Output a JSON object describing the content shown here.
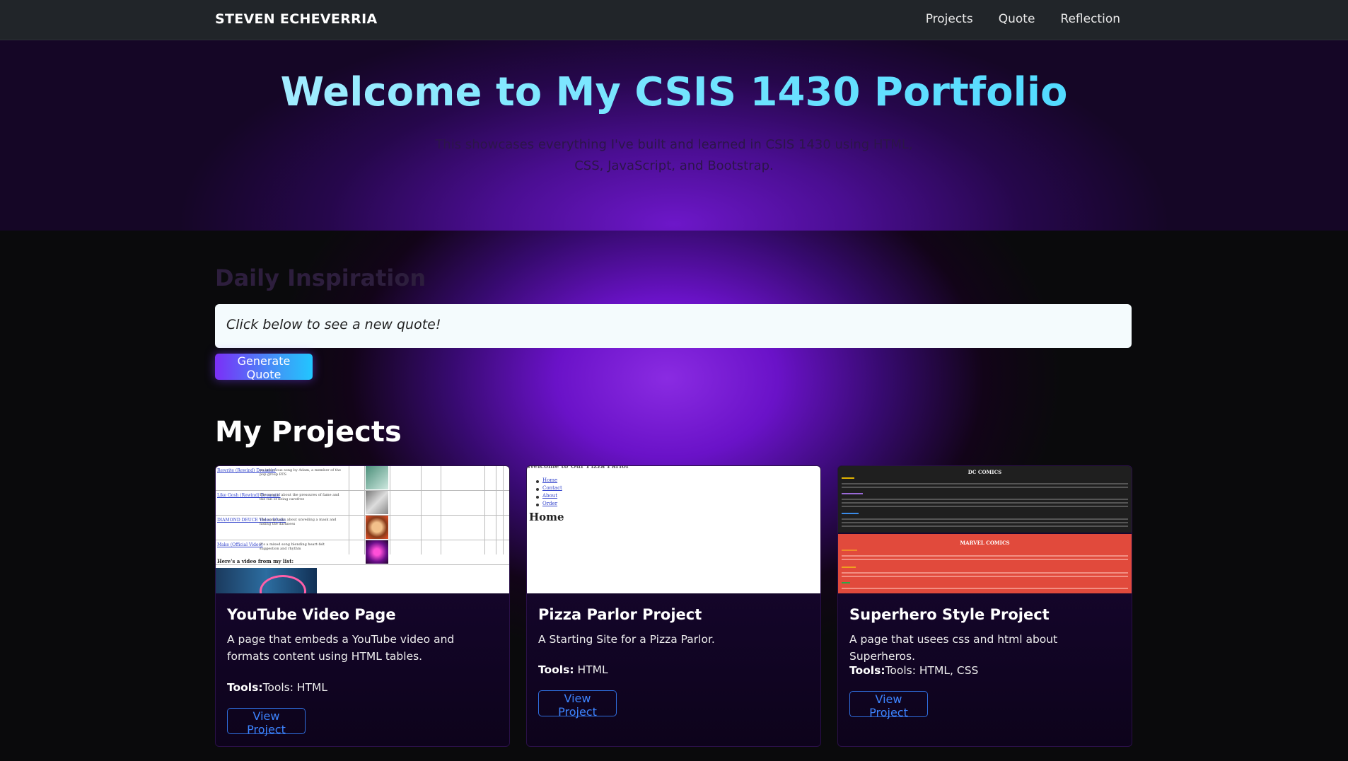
{
  "navbar": {
    "brand": "STEVEN ECHEVERRIA",
    "links": [
      "Projects",
      "Quote",
      "Reflection"
    ]
  },
  "hero": {
    "title": "Welcome to My CSIS 1430 Portfolio",
    "subtitle": "This showcases everything I've built and learned in CSIS 1430 using HTML, CSS, JavaScript, and Bootstrap."
  },
  "quote": {
    "heading": "Daily Inspiration",
    "text": "Click below to see a new quote!",
    "button": "Generate Quote"
  },
  "projects": {
    "heading": "My Projects",
    "items": [
      {
        "title": "YouTube Video Page",
        "description": "A page that embeds a YouTube video and formats content using HTML tables.",
        "tools_label": "Tools:",
        "tools": "Tools: HTML",
        "button": "View Project",
        "thumb": {
          "links": [
            "Rewrite (Rewind) Dreamin'",
            "Like Gosh (Rewind) Dreamin'",
            "DIAMOND DEUCE Video Music",
            "Make (Official Video)"
          ],
          "caption": "Here's a video from my list:"
        }
      },
      {
        "title": "Pizza Parlor Project",
        "description": "A Starting Site for a Pizza Parlor.",
        "tools_label": "Tools:",
        "tools": " HTML",
        "button": "View Project",
        "thumb": {
          "links": [
            "Home",
            "Contact",
            "About",
            "Order"
          ],
          "heading": "Home"
        }
      },
      {
        "title": "Superhero Style Project",
        "description": "A page that usees css and html about Superheros.",
        "tools_label": "Tools:",
        "tools": "Tools: HTML, CSS",
        "button": "View Project",
        "thumb": {
          "top_heading": "DC COMICS",
          "bottom_heading": "MARVEL COMICS"
        }
      }
    ]
  },
  "colors": {
    "navbar_bg": "#212529",
    "accent_button_start": "#7b2ff7",
    "accent_button_end": "#22c6ff",
    "outline_button": "#3d84ff",
    "page_bg": "#0a0a0c"
  }
}
